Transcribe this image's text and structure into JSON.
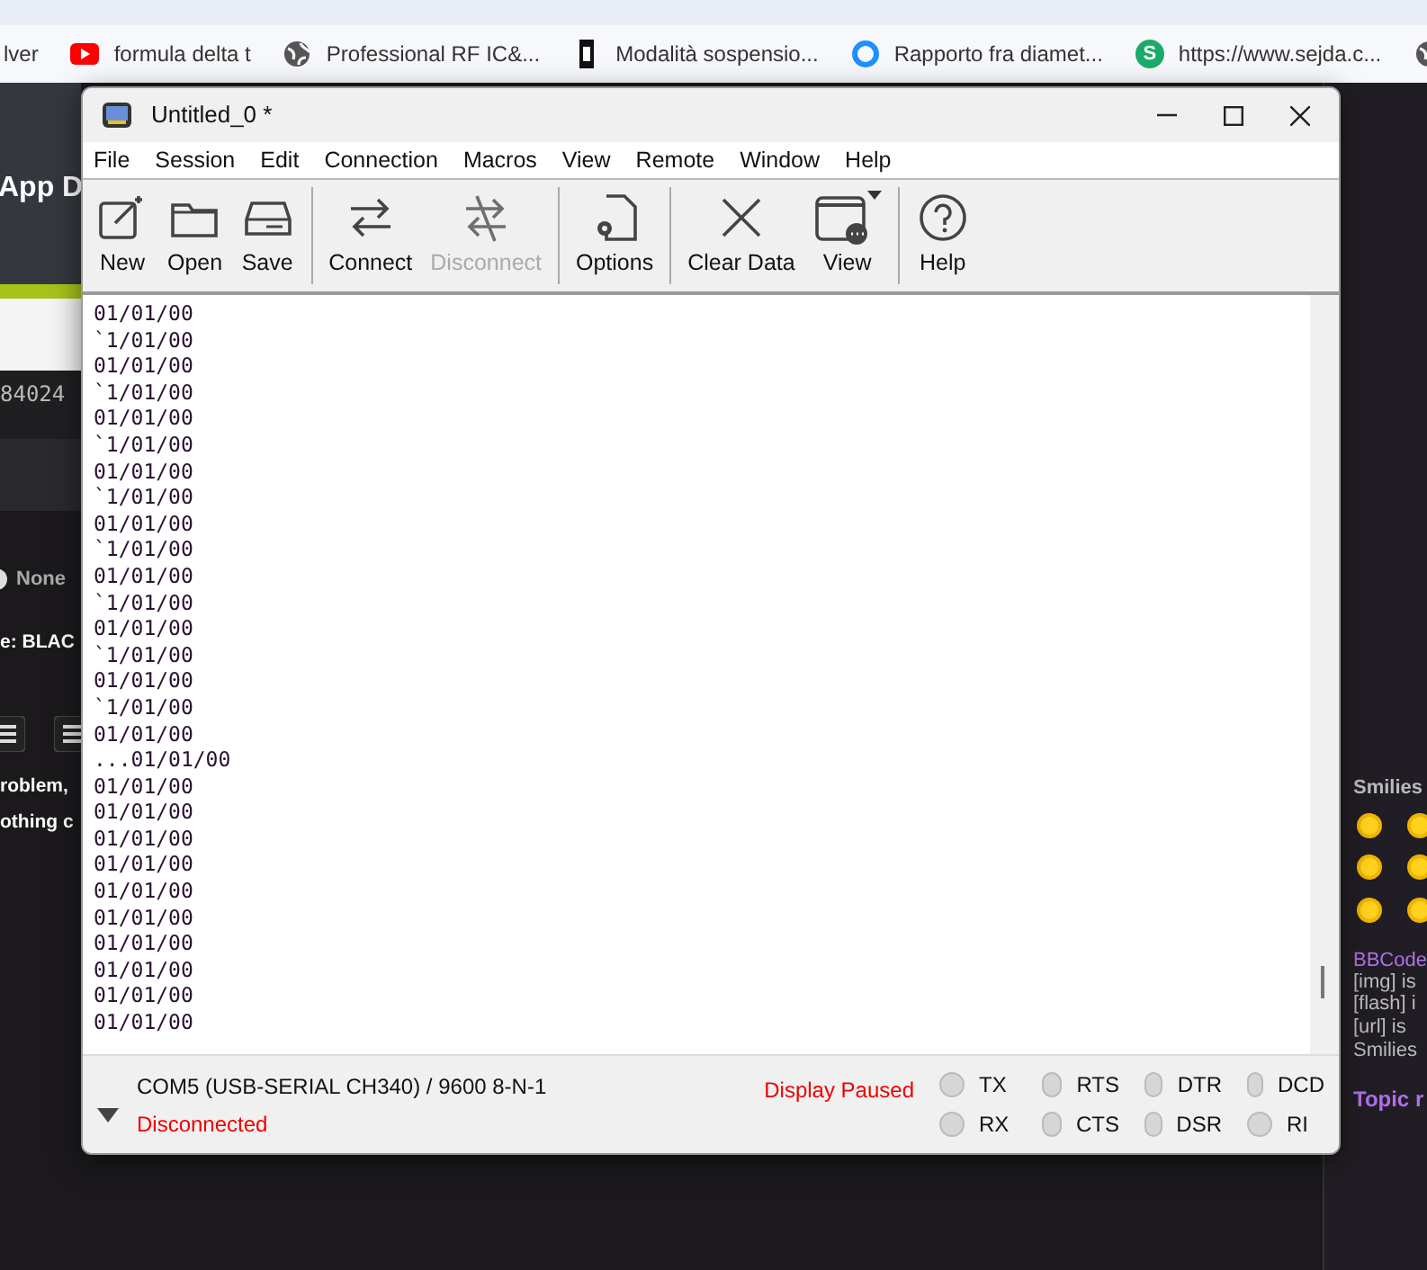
{
  "bookmarks": [
    {
      "label": "lver",
      "kind": "none"
    },
    {
      "label": "formula delta t",
      "kind": "video"
    },
    {
      "label": "Professional RF IC&...",
      "kind": "globe"
    },
    {
      "label": "Modalità sospensio...",
      "kind": "chip"
    },
    {
      "label": "Rapporto fra diamet...",
      "kind": "ring"
    },
    {
      "label": "https://www.sejda.c...",
      "kind": "letter",
      "badge": "S"
    },
    {
      "kind": "globe"
    }
  ],
  "background_page": {
    "left_texts": [
      {
        "text": "App D",
        "kind": "heading"
      },
      {
        "text": "84024",
        "kind": "number"
      },
      {
        "text": "None",
        "kind": "radio"
      },
      {
        "text": "e: BLAC",
        "kind": "bold"
      },
      {
        "text": "roblem,",
        "kind": "bold"
      },
      {
        "text": "othing c",
        "kind": "bold"
      }
    ],
    "right_texts": [
      {
        "text": "Smilies",
        "kind": "heading"
      },
      {
        "text": "BBCode",
        "kind": "link"
      },
      {
        "text": "[img] is",
        "kind": "plain"
      },
      {
        "text": "[flash] i",
        "kind": "plain"
      },
      {
        "text": "[url] is",
        "kind": "plain"
      },
      {
        "text": "Smilies",
        "kind": "plain"
      },
      {
        "text": "Topic r",
        "kind": "link-bold"
      }
    ]
  },
  "window": {
    "title": "Untitled_0 *",
    "menu": [
      "File",
      "Session",
      "Edit",
      "Connection",
      "Macros",
      "View",
      "Remote",
      "Window",
      "Help"
    ],
    "toolbar": [
      {
        "label": "New",
        "disabled": false
      },
      {
        "label": "Open",
        "disabled": false
      },
      {
        "label": "Save",
        "disabled": false
      },
      {
        "label": "Connect",
        "disabled": false
      },
      {
        "label": "Disconnect",
        "disabled": true
      },
      {
        "label": "Options",
        "disabled": false
      },
      {
        "label": "Clear Data",
        "disabled": false
      },
      {
        "label": "View",
        "disabled": false,
        "dropdown": true
      },
      {
        "label": "Help",
        "disabled": false
      }
    ],
    "terminal_lines": [
      "01/01/00",
      "`1/01/00",
      "01/01/00",
      "`1/01/00",
      "01/01/00",
      "`1/01/00",
      "01/01/00",
      "`1/01/00",
      "01/01/00",
      "`1/01/00",
      "01/01/00",
      "`1/01/00",
      "01/01/00",
      "`1/01/00",
      "01/01/00",
      "`1/01/00",
      "01/01/00",
      "...01/01/00",
      "01/01/00",
      "01/01/00",
      "01/01/00",
      "01/01/00",
      "01/01/00",
      "01/01/00",
      "01/01/00",
      "01/01/00",
      "01/01/00",
      "01/01/00"
    ],
    "status_bar": {
      "port": "COM5 (USB-SERIAL CH340) / 9600 8-N-1",
      "connection": "Disconnected",
      "display": "Display Paused",
      "signals": [
        {
          "label": "TX",
          "on": false
        },
        {
          "label": "RX",
          "on": false
        },
        {
          "label": "RTS",
          "on": false
        },
        {
          "label": "CTS",
          "on": false
        },
        {
          "label": "DTR",
          "on": false
        },
        {
          "label": "DSR",
          "on": false
        },
        {
          "label": "DCD",
          "on": false
        },
        {
          "label": "RI",
          "on": false
        }
      ]
    }
  }
}
